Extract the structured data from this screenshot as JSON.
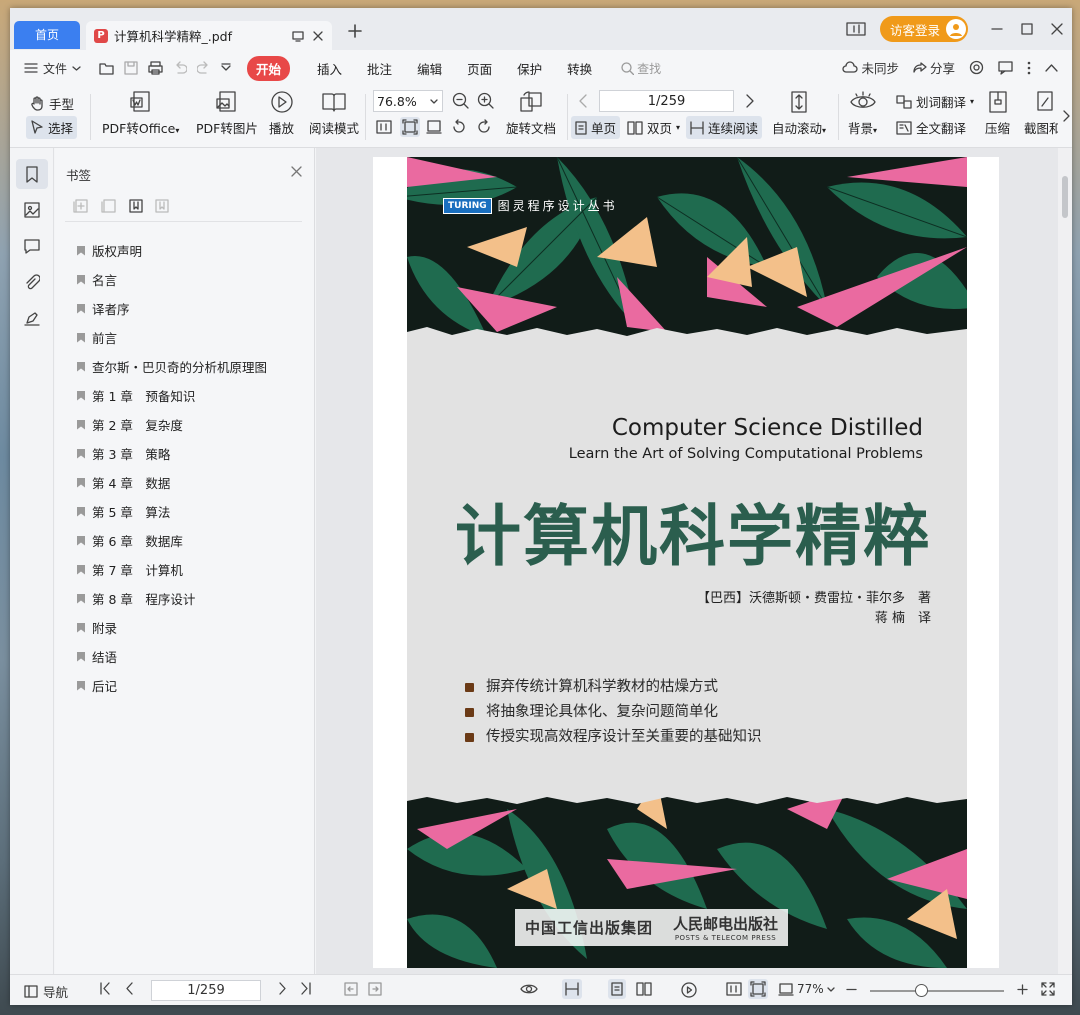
{
  "tabs": {
    "home": "首页",
    "doc": "计算机科学精粹_.pdf"
  },
  "account": {
    "guest_login": "访客登录"
  },
  "menu": {
    "file": "文件",
    "start": "开始",
    "insert": "插入",
    "comment": "批注",
    "edit": "编辑",
    "page": "页面",
    "protect": "保护",
    "convert": "转换",
    "search": "查找",
    "unsynced": "未同步",
    "share": "分享"
  },
  "ribbon": {
    "hand": "手型",
    "select": "选择",
    "pdf_to_office": "PDF转Office",
    "pdf_to_image": "PDF转图片",
    "play": "播放",
    "read_mode": "阅读模式",
    "zoom": "76.8%",
    "rotate_doc": "旋转文档",
    "page_num": "1/259",
    "single": "单页",
    "double": "双页",
    "continuous": "连续阅读",
    "auto_scroll": "自动滚动",
    "background": "背景",
    "word_translate": "划词翻译",
    "full_translate": "全文翻译",
    "compress": "压缩",
    "screenshot": "截图和"
  },
  "bookmarks": {
    "title": "书签",
    "items": [
      "版权声明",
      "名言",
      "译者序",
      "前言",
      "查尔斯・巴贝奇的分析机原理图",
      "第 1 章　预备知识",
      "第 2 章　复杂度",
      "第 3 章　策略",
      "第 4 章　数据",
      "第 5 章　算法",
      "第 6 章　数据库",
      "第 7 章　计算机",
      "第 8 章　程序设计",
      "附录",
      "结语",
      "后记"
    ]
  },
  "cover": {
    "series_badge": "TURING",
    "series": "图灵程序设计丛书",
    "en_title": "Computer Science Distilled",
    "en_subtitle": "Learn the Art of Solving Computational Problems",
    "cn_title": "计算机科学精粹",
    "author": "【巴西】沃德斯顿・费雷拉・菲尔多　著",
    "translator": "蒋 楠　译",
    "bullets": [
      "摒弃传统计算机科学教材的枯燥方式",
      "将抽象理论具体化、复杂问题简单化",
      "传授实现高效程序设计至关重要的基础知识"
    ],
    "publisher1": "中国工信出版集团",
    "publisher2": "人民邮电出版社",
    "publisher2_en": "POSTS & TELECOM PRESS"
  },
  "status": {
    "nav": "导航",
    "page": "1/259",
    "zoom": "77%"
  },
  "colors": {
    "accent": "#3b7ff0",
    "start": "#e84848",
    "guest": "#f09a1a",
    "title_green": "#2b5e4e"
  }
}
